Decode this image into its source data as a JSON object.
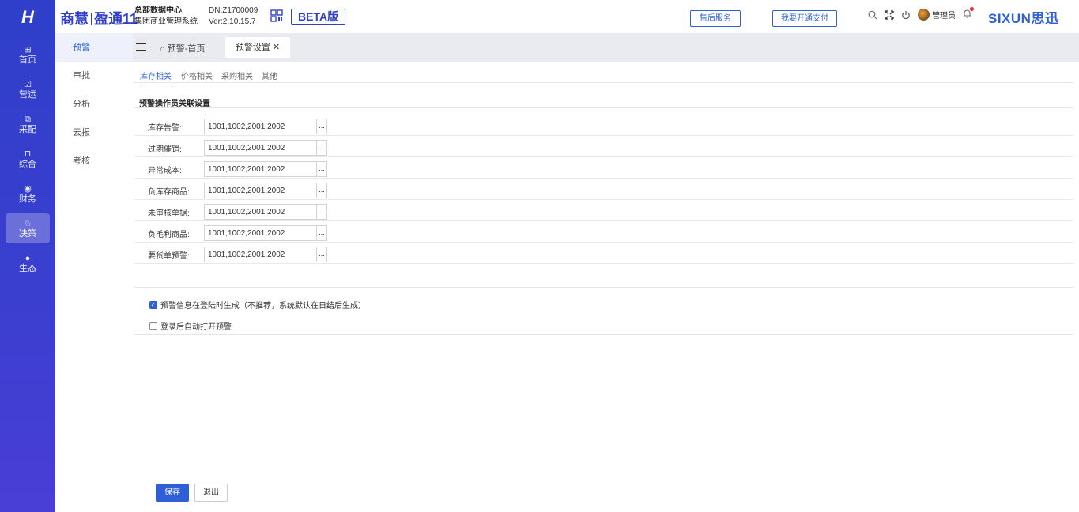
{
  "header": {
    "brand_left": "商慧",
    "brand_right": "盈通11",
    "org_name": "总部数据中心",
    "org_system": "集团商业管理系统",
    "dn": "DN:Z1700009",
    "version": "Ver:2.10.15.7",
    "beta": "BETA版",
    "service_button": "售后服务",
    "payment_button": "我要开通支付",
    "user": "管理员",
    "vendor_logo": "SIXUN思迅"
  },
  "rail": {
    "logo": "H",
    "items": [
      {
        "icon": "⊞",
        "label": "首页"
      },
      {
        "icon": "☑",
        "label": "营运"
      },
      {
        "icon": "⧉",
        "label": "采配"
      },
      {
        "icon": "⊓",
        "label": "综合"
      },
      {
        "icon": "◉",
        "label": "财务"
      },
      {
        "icon": "♘",
        "label": "决策"
      },
      {
        "icon": "●",
        "label": "生态"
      }
    ],
    "active_index": 5
  },
  "submenu": {
    "items": [
      "预警",
      "审批",
      "分析",
      "云报",
      "考核"
    ],
    "active_index": 0
  },
  "tabs": {
    "home": "预警-首页",
    "current": "预警设置",
    "close": "✕"
  },
  "subtabs": [
    "库存相关",
    "价格相关",
    "采购相关",
    "其他"
  ],
  "section_title": "预警操作员关联设置",
  "rows": [
    {
      "label": "库存告警:",
      "value": "1001,1002,2001,2002"
    },
    {
      "label": "过期催销:",
      "value": "1001,1002,2001,2002"
    },
    {
      "label": "异常成本:",
      "value": "1001,1002,2001,2002"
    },
    {
      "label": "负库存商品:",
      "value": "1001,1002,2001,2002"
    },
    {
      "label": "未审核单据:",
      "value": "1001,1002,2001,2002"
    },
    {
      "label": "负毛利商品:",
      "value": "1001,1002,2001,2002"
    },
    {
      "label": "要货单预警:",
      "value": "1001,1002,2001,2002"
    }
  ],
  "more_button": "...",
  "options": [
    {
      "label": "预警信息在登陆时生成（不推荐，系统默认在日结后生成）",
      "checked": true
    },
    {
      "label": "登录后自动打开预警",
      "checked": false
    }
  ],
  "buttons": {
    "save": "保存",
    "exit": "退出"
  },
  "colors": {
    "primary": "#2f5fd6",
    "rail": "#3b3fd0"
  }
}
